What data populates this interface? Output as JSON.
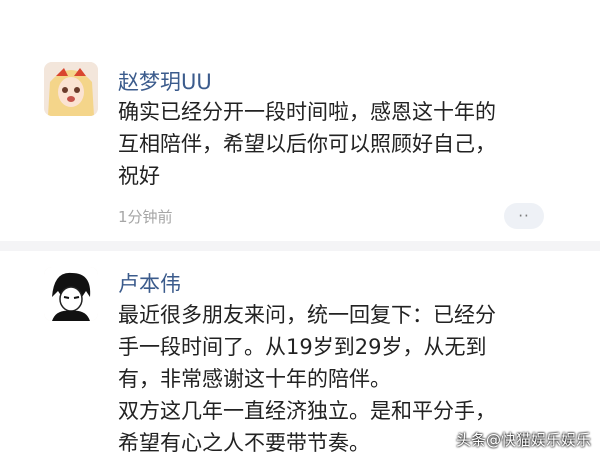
{
  "posts": [
    {
      "username": "赵梦玥UU",
      "content": "确实已经分开一段时间啦，感恩这十年的\n互相陪伴，希望以后你可以照顾好自己，\n祝好",
      "time": "1分钟前",
      "more": "··"
    },
    {
      "username": "卢本伟",
      "content": "最近很多朋友来问，统一回复下：已经分\n手一段时间了。从19岁到29岁，从无到\n有，非常感谢这十年的陪伴。\n双方这几年一直经济独立。是和平分手，\n希望有心之人不要带节奏。"
    }
  ],
  "watermark": "头条@快猫娱乐娱乐"
}
